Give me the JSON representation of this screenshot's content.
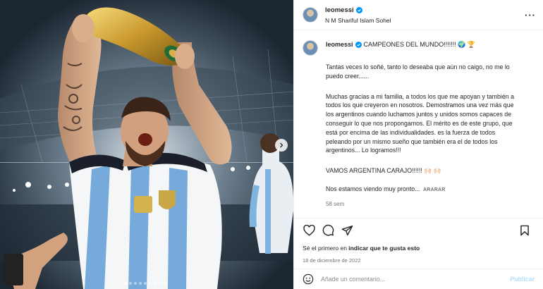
{
  "post": {
    "username": "leomessi",
    "subline": "N M Shariful Islam Sohel",
    "more_icon": "more-horizontal-icon",
    "caption_title": "CAMPEONES DEL MUNDO!!!!!!! 🌍 🏆",
    "paragraphs": [
      "Tantas veces lo soñé, tanto lo deseaba que aún no caigo, no me lo puedo creer......",
      "Muchas gracias a mi familia, a todos los que me apoyan y también a todos los que creyeron en nosotros. Demostramos una vez más que los argentinos cuando luchamos juntos y unidos somos capaces de conseguir lo que nos propongamos. El mérito es de este grupo, que está por encima de las individualidades. es la fuerza de todos peleando por un mismo sueño que también era el de todos los argentinos... Lo logramos!!!",
      "VAMOS ARGENTINA CARAJO!!!!!! 🙌🏻 🙌🏻",
      "Nos estamos viendo muy pronto..."
    ],
    "translate_label": "ARARAR",
    "age": "58 sem",
    "likes_text_plain": "Sé el primero en ",
    "likes_text_bold": "indicar que te gusta esto",
    "date": "18 de diciembre de 2022",
    "comment_placeholder": "Añade un comentario...",
    "publish_label": "Publicar"
  },
  "carousel": {
    "slides": 9,
    "active_index": 0
  },
  "colors": {
    "verified": "#0095f6",
    "publish": "#b2dffc",
    "muted": "#737373",
    "border": "#efefef"
  }
}
